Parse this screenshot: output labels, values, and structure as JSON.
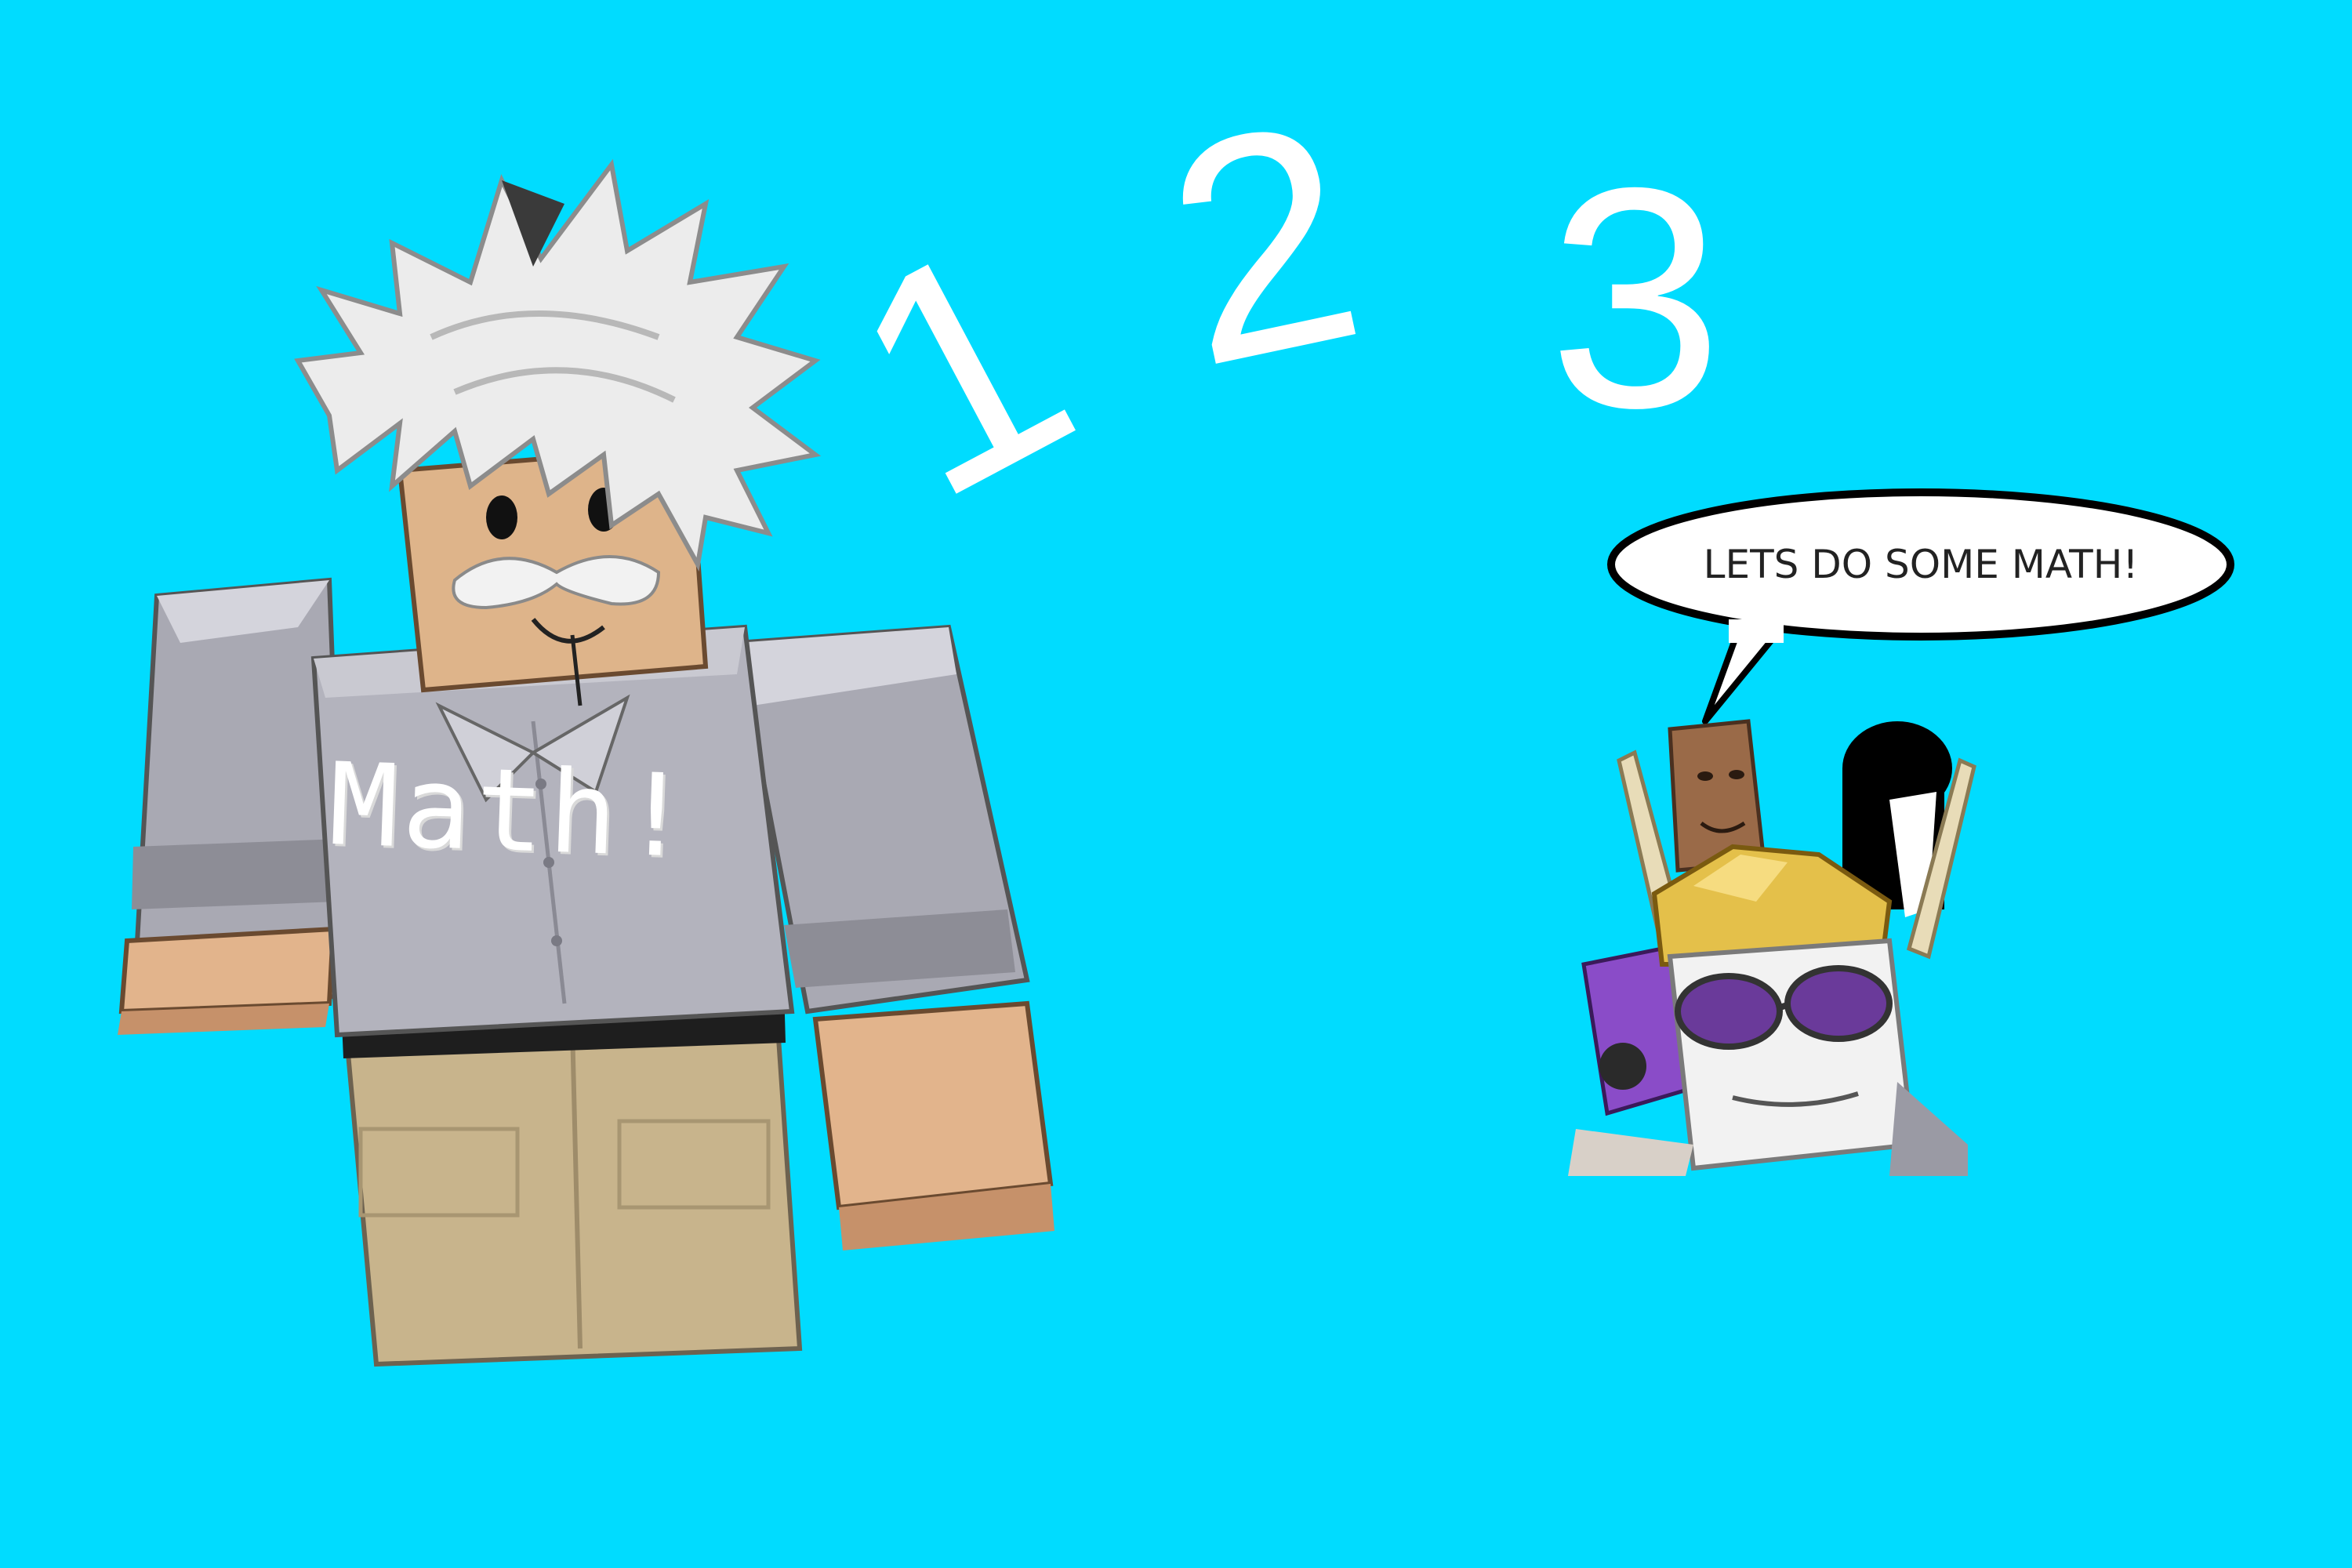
{
  "scene": {
    "background_color": "#00dcff",
    "numbers": [
      "1",
      "2",
      "3"
    ],
    "shirt_text": "Math!",
    "speech_bubble_text": "LETS DO SOME MATH!"
  },
  "icons": {
    "main_character": "blocky-avatar-white-hair-mustache",
    "character_group": "avatar-group-with-sunglasses"
  }
}
